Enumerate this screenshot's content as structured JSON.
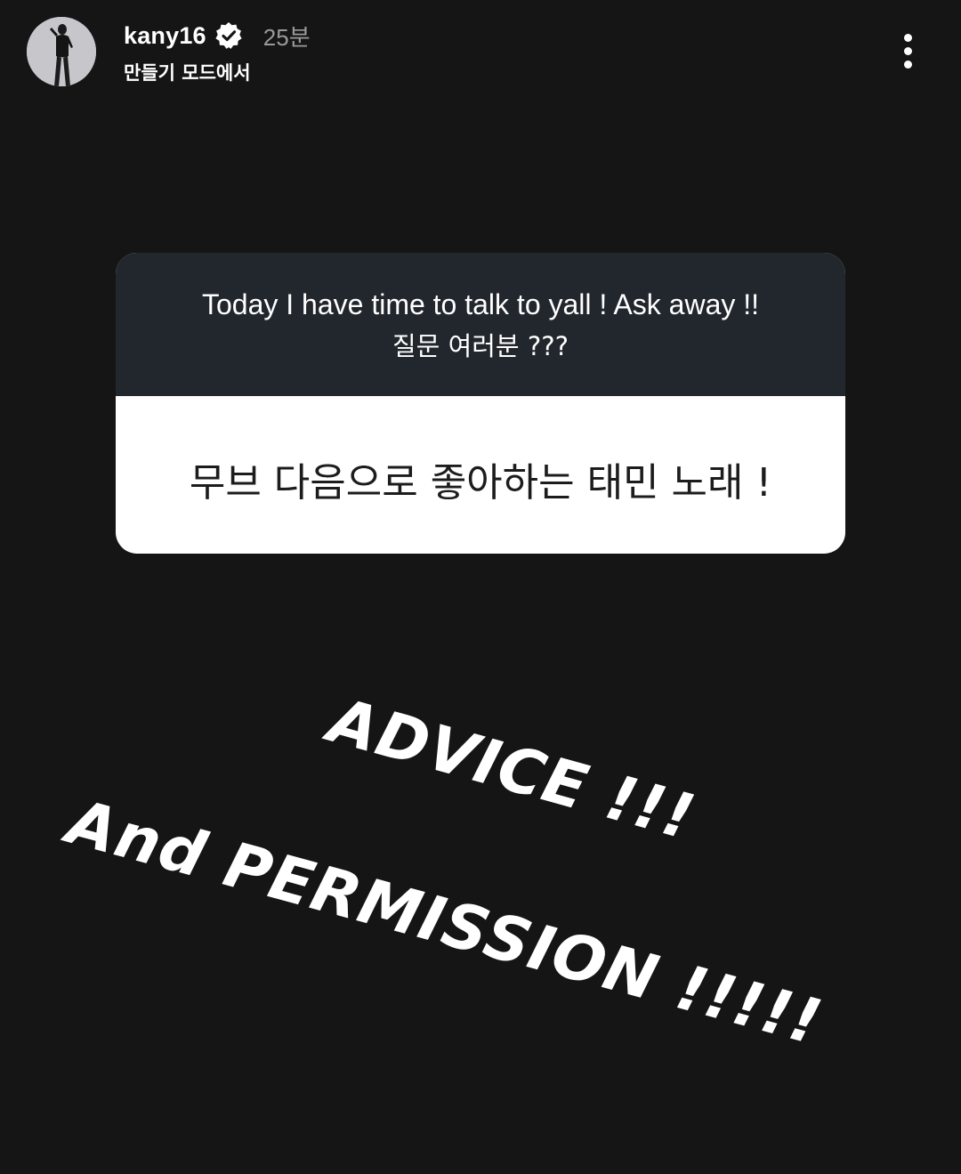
{
  "header": {
    "username": "kany16",
    "verified_icon": "verified-badge-icon",
    "time_ago": "25분",
    "subtitle": "만들기 모드에서",
    "more_icon": "more-vertical-icon"
  },
  "question_sticker": {
    "prompt_line1": "Today I have time to talk to yall ! Ask away !!",
    "prompt_line2": "질문 여러분 ???",
    "answer": "무브 다음으로 좋아하는 태민 노래 !",
    "colors": {
      "header_bg": "#22272e",
      "body_bg": "#ffffff"
    }
  },
  "text_stickers": {
    "line1": "ADVICE !!!",
    "line2": "And PERMISSION !!!!!"
  },
  "colors": {
    "background": "#151515",
    "time_text": "#9a9a9a"
  }
}
